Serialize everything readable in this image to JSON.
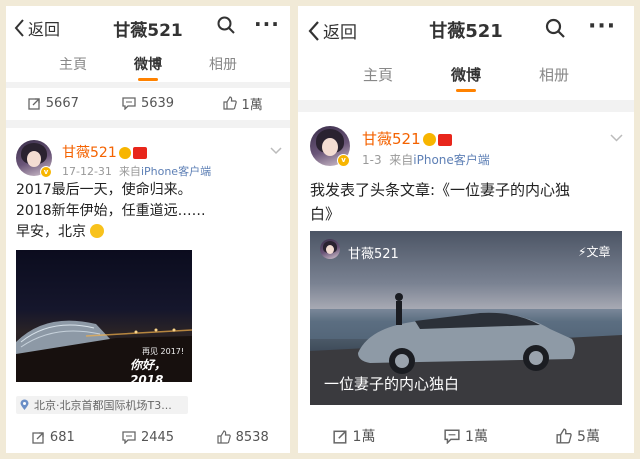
{
  "left": {
    "header": {
      "back_label": "返回",
      "title": "甘薇521"
    },
    "tabs": [
      {
        "label": "主頁"
      },
      {
        "label": "微博"
      },
      {
        "label": "相册"
      }
    ],
    "prev_actions": {
      "repost": "5667",
      "comment": "5639",
      "like": "1萬"
    },
    "post": {
      "username": "甘薇521",
      "timestamp": "17-12-31",
      "source_prefix": "来自",
      "source": "iPhone客户端",
      "text_lines": [
        "2017最后一天，使命归来。",
        "2018新年伊始，任重道远……",
        "早安，北京"
      ],
      "image_caption_small": "再见 2017!",
      "image_caption": "你好，2018",
      "location": "北京·北京首都国际机场T3...",
      "actions": {
        "repost": "681",
        "comment": "2445",
        "like": "8538"
      }
    }
  },
  "right": {
    "header": {
      "back_label": "返回",
      "title": "甘薇521"
    },
    "tabs": [
      {
        "label": "主頁"
      },
      {
        "label": "微博"
      },
      {
        "label": "相册"
      }
    ],
    "post": {
      "username": "甘薇521",
      "timestamp": "1-3",
      "source_prefix": "来自",
      "source": "iPhone客户端",
      "text_line1": "我发表了头条文章:《一位妻子的内心独",
      "text_line2": "白》",
      "card": {
        "author": "甘薇521",
        "tag": "文章",
        "title": "一位妻子的内心独白"
      },
      "actions": {
        "repost": "1萬",
        "comment": "1萬",
        "like": "5萬"
      }
    }
  },
  "colors": {
    "accent": "#ff8200",
    "username": "#f46200",
    "link": "#5d7fb5"
  }
}
